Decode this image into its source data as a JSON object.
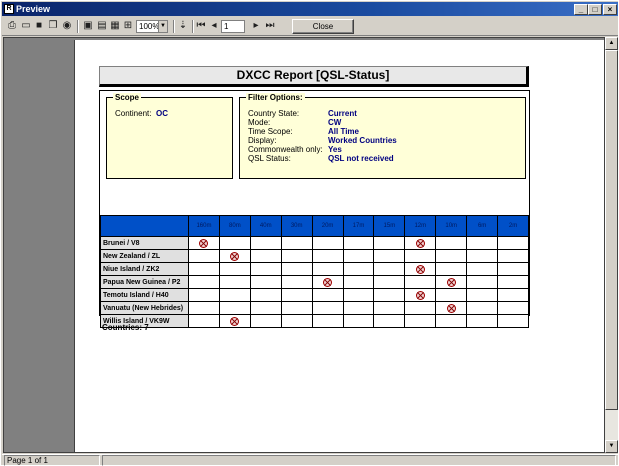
{
  "window": {
    "title": "Preview"
  },
  "toolbar": {
    "zoom_value": "100%",
    "page_value": "1",
    "close_label": "Close"
  },
  "report": {
    "title": "DXCC Report [QSL-Status]",
    "scope": {
      "heading": "Scope",
      "continent_label": "Continent:",
      "continent_value": "OC"
    },
    "filter": {
      "heading": "Filter Options:",
      "rows": [
        {
          "label": "Country State:",
          "value": "Current"
        },
        {
          "label": "Mode:",
          "value": "CW"
        },
        {
          "label": "Time Scope:",
          "value": "All Time"
        },
        {
          "label": "Display:",
          "value": "Worked Countries"
        },
        {
          "label": "Commonwealth only:",
          "value": "Yes"
        },
        {
          "label": "QSL Status:",
          "value": "QSL not received"
        }
      ]
    },
    "bands": [
      "160m",
      "80m",
      "40m",
      "30m",
      "20m",
      "17m",
      "15m",
      "12m",
      "10m",
      "6m",
      "2m"
    ],
    "rows": [
      {
        "country": "Brunei / V8",
        "marks": [
          "160m",
          "12m"
        ]
      },
      {
        "country": "New Zealand / ZL",
        "marks": [
          "80m"
        ]
      },
      {
        "country": "Niue Island / ZK2",
        "marks": [
          "12m"
        ]
      },
      {
        "country": "Papua New Guinea / P2",
        "marks": [
          "20m",
          "10m"
        ]
      },
      {
        "country": "Temotu Island / H40",
        "marks": [
          "12m"
        ]
      },
      {
        "country": "Vanuatu (New Hebrides)",
        "marks": [
          "10m"
        ]
      },
      {
        "country": "Willis Island / VK9W",
        "marks": [
          "80m"
        ]
      }
    ],
    "countries_total": "Countries: 7"
  },
  "statusbar": {
    "page_text": "Page 1 of 1"
  },
  "icons": [
    "print-icon",
    "open-icon",
    "save-icon",
    "copy-icon",
    "find-icon",
    "page-single-icon",
    "page-width-icon",
    "page-multi-icon",
    "fit-icon",
    "zoom-dropdown-icon",
    "first-page-icon",
    "prev-page-icon",
    "next-page-icon",
    "last-page-icon"
  ]
}
